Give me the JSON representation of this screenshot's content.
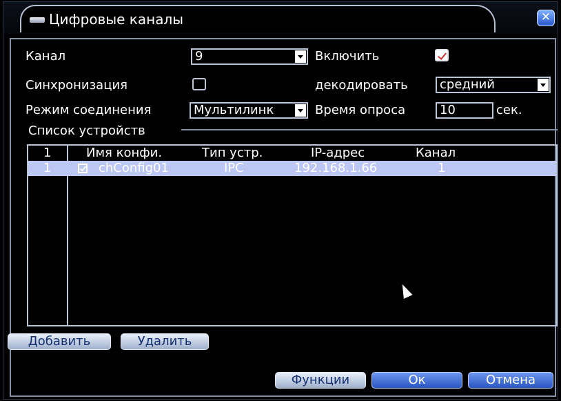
{
  "window": {
    "title": "Цифровые каналы"
  },
  "form": {
    "channel_label": "Канал",
    "channel_value": "9",
    "enable_label": "Включить",
    "enable_checked": true,
    "sync_label": "Синхронизация",
    "sync_checked": false,
    "decode_label": "декодировать",
    "decode_value": "средний",
    "mode_label": "Режим соединения",
    "mode_value": "Мультилинк",
    "poll_label": "Время опроса",
    "poll_value": "10",
    "poll_unit": "сек."
  },
  "device_list": {
    "title": "Список устройств",
    "columns": [
      "1",
      "Имя конфи.",
      "Тип устр.",
      "IP-адрес",
      "Канал"
    ],
    "rows": [
      {
        "index": "1",
        "checked": true,
        "name": "chConfig01",
        "type": "IPC",
        "ip": "192.168.1.66",
        "channel": "1"
      }
    ]
  },
  "buttons": {
    "add": "Добавить",
    "delete": "Удалить",
    "functions": "Функции",
    "ok": "Ок",
    "cancel": "Отмена"
  },
  "icons": {
    "close": "close-icon",
    "title": "window-icon",
    "pointer": "mouse-pointer-icon"
  },
  "colors": {
    "selection": "#bcc7f3",
    "accent": "#2a56c0",
    "frame": "#8391a8"
  }
}
